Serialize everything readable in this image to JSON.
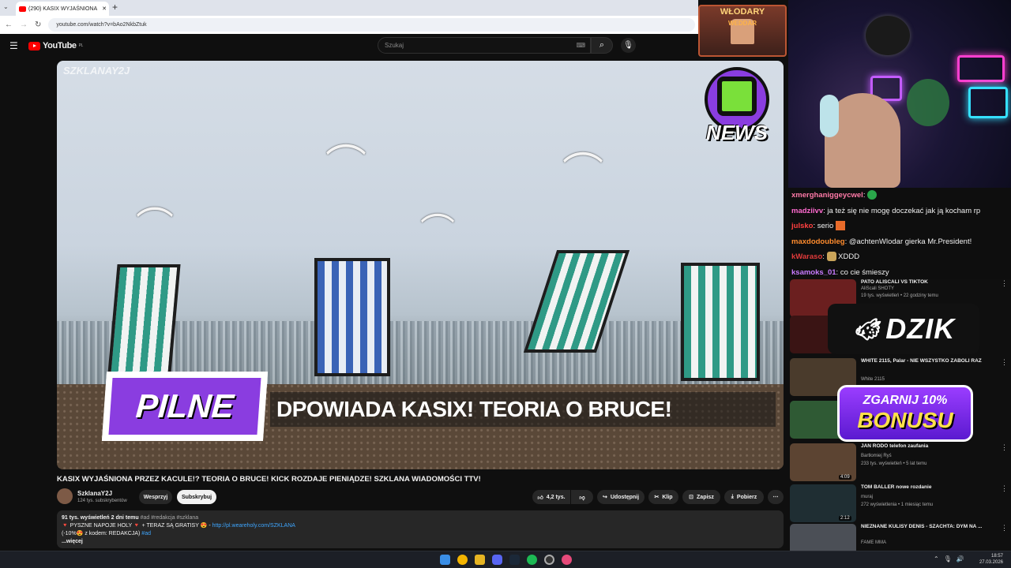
{
  "browser": {
    "tab_title": "(290) KASIX WYJAŚNIONA",
    "address": "youtube.com/watch?v=bAo2NkbZtuk",
    "new_tab_icon": "+"
  },
  "youtube": {
    "logo_text": "YouTube",
    "logo_region": "PL",
    "search_placeholder": "Szukaj"
  },
  "video": {
    "watermark": "SZKLANAY2J",
    "corner_badge": "NEWS",
    "pilne": "PILNE",
    "banner": "DPOWIADA KASIX! TEORIA O BRUCE!",
    "title": "KASIX WYJAŚNIONA PRZEZ KACULE!? TEORIA O BRUCE! KICK ROZDAJE PIENIĄDZE! SZKLANA WIADOMOŚCI TTV!",
    "channel_name": "SzklanaY2J",
    "channel_subs": "124 tys. subskrybentów",
    "support_label": "Wesprzyj",
    "subscribe_label": "Subskrybuj",
    "likes": "4,2 tys.",
    "share_label": "Udostępnij",
    "clip_label": "Klip",
    "save_label": "Zapisz",
    "download_label": "Pobierz",
    "desc_stats": "91 tys. wyświetleń  2 dni temu",
    "desc_tags": "#ad #redakcja #szklana",
    "desc_line2_pre": "🔻 PYSZNE NAPOJE HOLY 🔻 + TERAZ SĄ GRATISY 😍 - ",
    "desc_link": "http://pl.weareholy.com/SZKLANA",
    "desc_line3": "(-10%😍 z kodem: REDAKCJA) ",
    "desc_line3_tag": "#ad",
    "desc_more": "...więcej"
  },
  "overlay": {
    "wlodary_line1": "WŁODARY",
    "wlodary_line2": "WEDDAR",
    "dzik": "DZIK",
    "bonus_line1": "ZGARNIJ 10%",
    "bonus_line2": "BONUSU"
  },
  "chat": [
    {
      "user": "xmerghaniggeycwel",
      "color": "#ff7aa8",
      "text": ""
    },
    {
      "user": "madziivv",
      "color": "#ff6bd0",
      "text": "ja też się nie mogę doczekać jak ją kocham rp"
    },
    {
      "user": "julsko",
      "color": "#ff4040",
      "text": "serio"
    },
    {
      "user": "maxdodoubleg",
      "color": "#ff8c2e",
      "text": "@achtenWlodar gierka Mr.President!"
    },
    {
      "user": "kWaraso",
      "color": "#e23b3b",
      "text": "XDDD"
    },
    {
      "user": "ksamoks_01",
      "color": "#c87bff",
      "text": "co cie śmieszy"
    }
  ],
  "sidebar": [
    {
      "title": "PATO ALISCALI VS TIKTOK",
      "channel": "AliScali SHOTY",
      "meta": "19 tys. wyświetleń • 22 godziny temu",
      "duration": ""
    },
    {
      "title": "",
      "channel": "",
      "meta": "",
      "duration": ""
    },
    {
      "title": "WHITE 2115, Palar - NIE WSZYSTKO ZABOLI RAZ",
      "channel": "White 2115",
      "meta": "",
      "duration": ""
    },
    {
      "title": "",
      "channel": "",
      "meta": "",
      "duration": ""
    },
    {
      "title": "JAN RODO telefon zaufania",
      "channel": "Bartłomiej Ryś",
      "meta": "233 tys. wyświetleń • 5 lat temu",
      "duration": "4:09"
    },
    {
      "title": "TOM BALLER nowe rozdanie",
      "channel": "muraj",
      "meta": "272 wyświetlenia • 1 miesiąc temu",
      "duration": "2:12"
    },
    {
      "title": "NIEZNANE KULISY DENIS - SZACHTA: DYM NA ...",
      "channel": "FAME MMA",
      "meta": "",
      "duration": ""
    }
  ],
  "taskbar": {
    "time": "18:57",
    "date": "27.03.2026"
  }
}
